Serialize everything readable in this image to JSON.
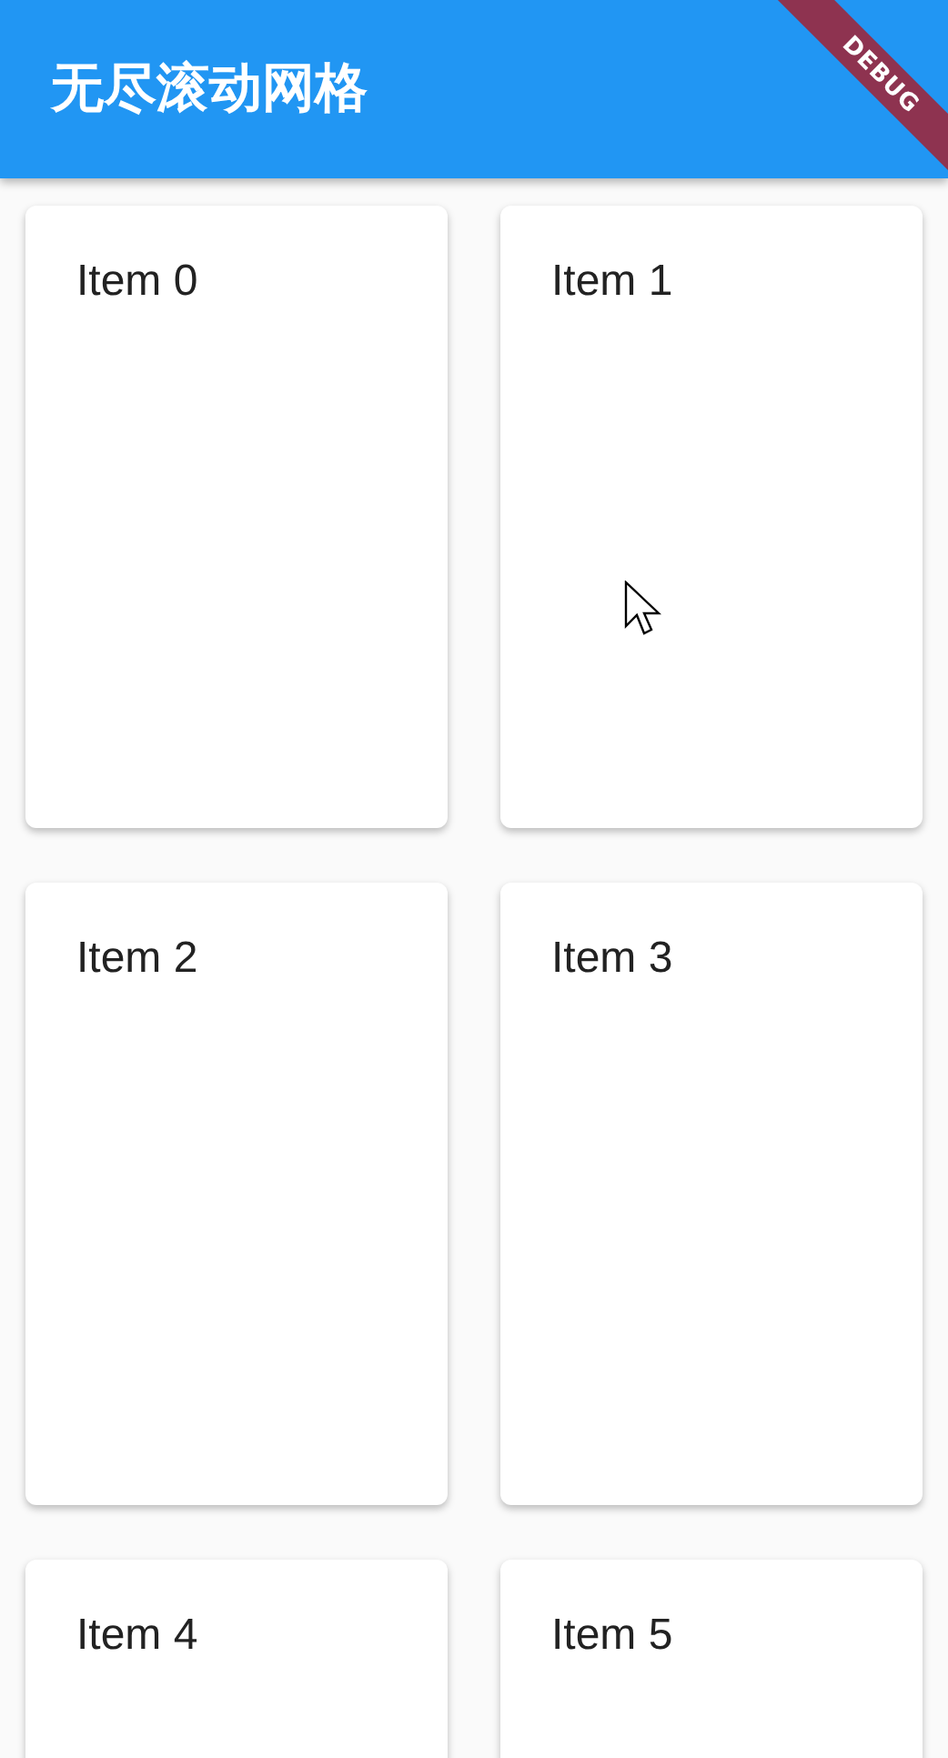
{
  "app_bar": {
    "title": "无尽滚动网格"
  },
  "debug_banner": {
    "label": "DEBUG"
  },
  "items": [
    {
      "label": "Item 0"
    },
    {
      "label": "Item 1"
    },
    {
      "label": "Item 2"
    },
    {
      "label": "Item 3"
    },
    {
      "label": "Item 4"
    },
    {
      "label": "Item 5"
    }
  ]
}
